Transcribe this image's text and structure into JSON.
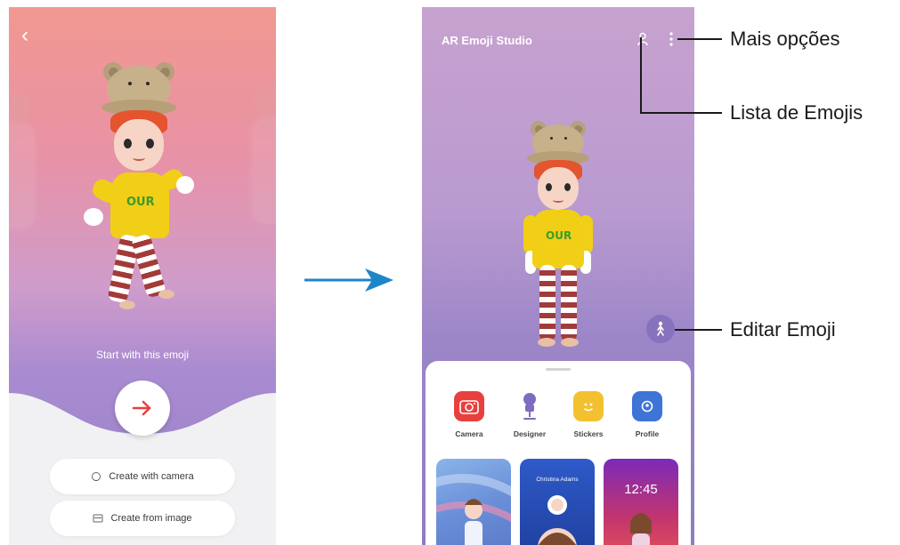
{
  "left_screen": {
    "back_icon": "chevron-left-icon",
    "prompt_text": "Start with this emoji",
    "next_button_icon": "arrow-right-icon",
    "buttons": [
      {
        "label": "Create with camera",
        "icon": "camera-shutter-icon"
      },
      {
        "label": "Create from image",
        "icon": "image-icon"
      }
    ]
  },
  "flow_arrow_icon": "arrow-right-icon",
  "right_screen": {
    "title": "AR Emoji Studio",
    "top_icons": [
      "emoji-list-icon",
      "more-options-icon"
    ],
    "edit_button_icon": "person-edit-icon",
    "features": [
      {
        "label": "Camera",
        "icon": "camera-icon",
        "color": "#e8403f"
      },
      {
        "label": "Designer",
        "icon": "designer-icon",
        "color": "#7f6cc0"
      },
      {
        "label": "Stickers",
        "icon": "sticker-icon",
        "color": "#f3c12f"
      },
      {
        "label": "Profile",
        "icon": "profile-card-icon",
        "color": "#3d74d6"
      }
    ],
    "cards": [
      {
        "name": "wallpaper-card"
      },
      {
        "name": "contact-card",
        "text": "Christina Adams"
      },
      {
        "name": "lockscreen-card",
        "text": "12:45"
      }
    ]
  },
  "callouts": {
    "more_options": "Mais opções",
    "emoji_list": "Lista de Emojis",
    "edit_emoji": "Editar Emoji"
  },
  "colors": {
    "accent_red": "#e8403f",
    "flow_arrow": "#1d86c8",
    "purple": "#8672bd"
  }
}
